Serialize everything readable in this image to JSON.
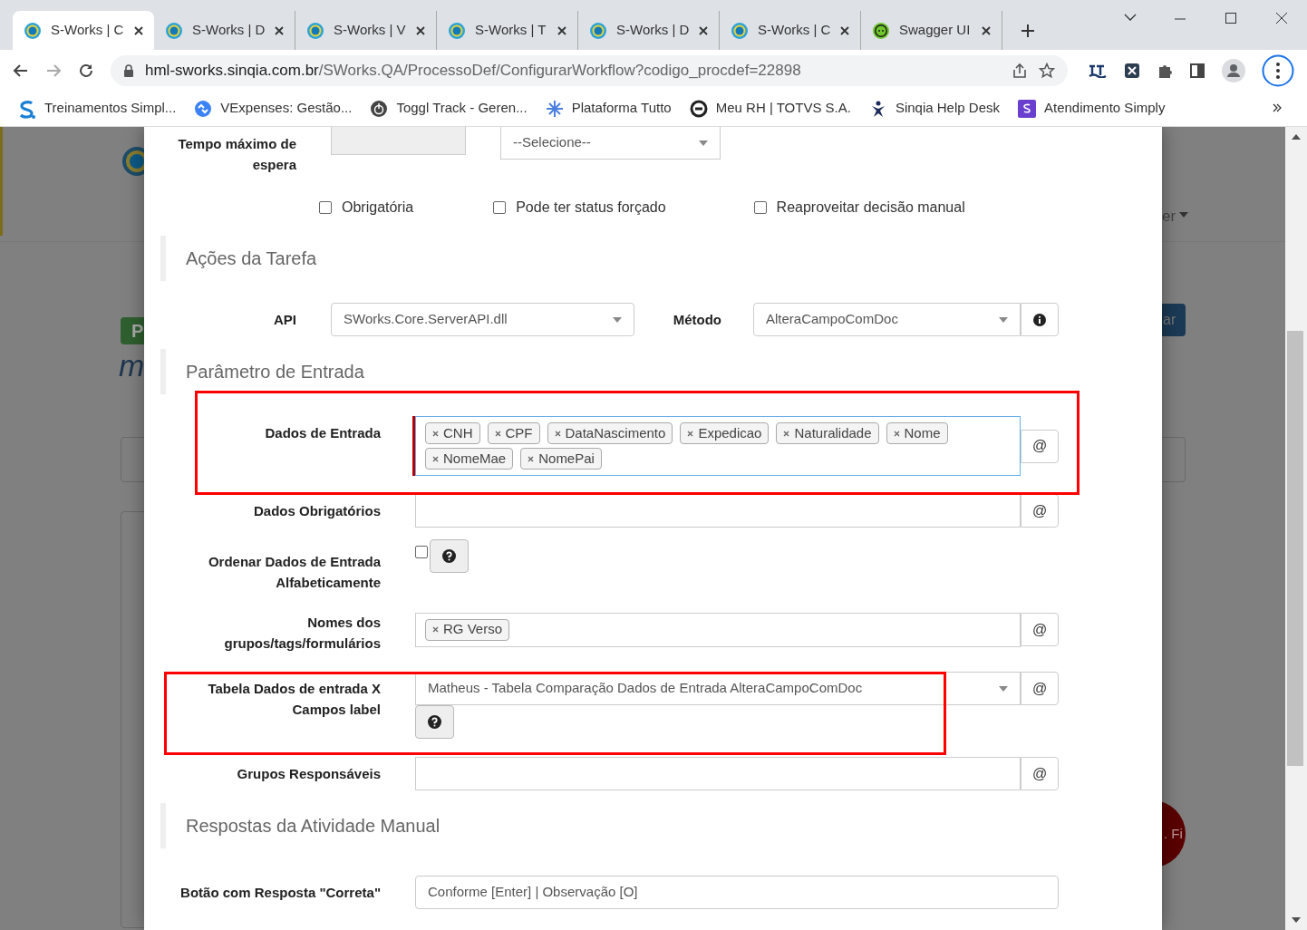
{
  "browser": {
    "tabs": [
      {
        "title": "S-Works | C",
        "kind": "sworks",
        "selected": true
      },
      {
        "title": "S-Works | D",
        "kind": "sworks",
        "selected": false
      },
      {
        "title": "S-Works | V",
        "kind": "sworks",
        "selected": false
      },
      {
        "title": "S-Works | T",
        "kind": "sworks",
        "selected": false
      },
      {
        "title": "S-Works | D",
        "kind": "sworks",
        "selected": false
      },
      {
        "title": "S-Works | C",
        "kind": "sworks",
        "selected": false
      },
      {
        "title": "Swagger UI",
        "kind": "swagger",
        "selected": false
      }
    ],
    "url": "hml-sworks.sinqia.com.br/SWorks.QA/ProcessoDef/ConfigurarWorkflow?codigo_procdef=22898",
    "bookmarks": [
      {
        "label": "Treinamentos Simpl...",
        "kind": "s-logo"
      },
      {
        "label": "VExpenses: Gestão...",
        "kind": "arrows"
      },
      {
        "label": "Toggl Track - Geren...",
        "kind": "power"
      },
      {
        "label": "Plataforma Tutto",
        "kind": "star"
      },
      {
        "label": "Meu RH | TOTVS S.A.",
        "kind": "ring"
      },
      {
        "label": "Sinqia Help Desk",
        "kind": "person"
      },
      {
        "label": "Atendimento Simply",
        "kind": "square"
      }
    ]
  },
  "background": {
    "badge": "P",
    "title_fragment": "m",
    "menu_fragment": "er",
    "button_fragment": "ar",
    "circle_fragment": ". Fi"
  },
  "form": {
    "wait_time": {
      "label": "Tempo máximo de espera",
      "unit": "--Selecione--"
    },
    "options": [
      {
        "label": "Obrigatória",
        "checked": false
      },
      {
        "label": "Pode ter status forçado",
        "checked": false
      },
      {
        "label": "Reaproveitar decisão manual",
        "checked": false
      }
    ],
    "rows": [
      {
        "kind": "heading",
        "text": "Ações da Tarefa"
      },
      {
        "kind": "api",
        "label": "API",
        "value": "SWorks.Core.ServerAPI.dll",
        "label2": "Método",
        "value2": "AlteraCampoComDoc"
      },
      {
        "kind": "heading",
        "text": "Parâmetro de Entrada"
      },
      {
        "kind": "tags",
        "label": "Dados de Entrada",
        "focused": true,
        "button": "@",
        "tags": [
          "CNH",
          "CPF",
          "DataNascimento",
          "Expedicao",
          "Naturalidade",
          "Nome",
          "NomeMae",
          "NomePai"
        ]
      },
      {
        "kind": "input",
        "label": "Dados Obrigatórios",
        "button": "@"
      },
      {
        "kind": "check_help",
        "label": "Ordenar Dados de Entrada Alfabeticamente",
        "checked": false
      },
      {
        "kind": "tags",
        "label": "Nomes dos grupos/tags/formulários",
        "focused": false,
        "button": "@",
        "tags": [
          "RG Verso"
        ]
      },
      {
        "kind": "select_help",
        "label": "Tabela Dados de entrada X Campos label",
        "value": "Matheus - Tabela Comparação Dados de Entrada AlteraCampoComDoc",
        "button": "@"
      },
      {
        "kind": "input",
        "label": "Grupos Responsáveis",
        "button": "@"
      },
      {
        "kind": "heading",
        "text": "Respostas da Atividade Manual"
      },
      {
        "kind": "input",
        "label": "Botão com Resposta \"Correta\"",
        "value": "Conforme [Enter] | Observação [O]"
      }
    ]
  }
}
